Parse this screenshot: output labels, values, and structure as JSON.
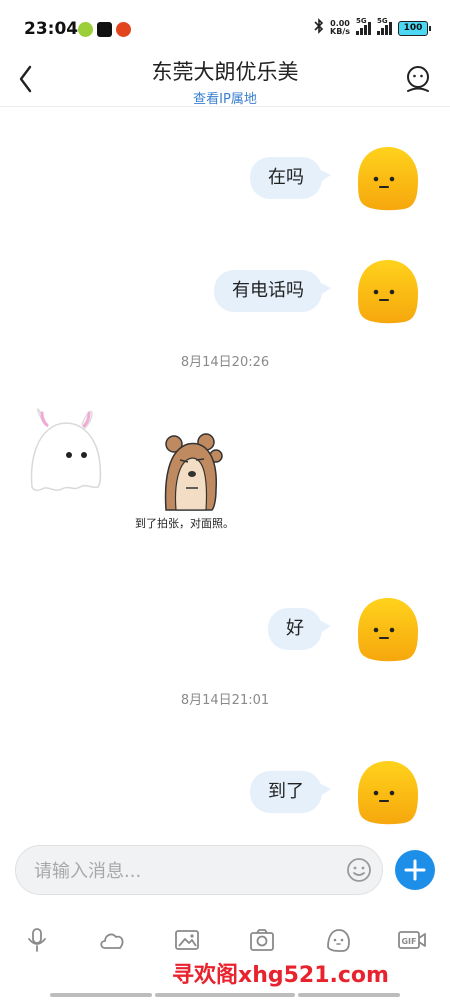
{
  "status_bar": {
    "time": "23:04",
    "net_speed_value": "0.00",
    "net_speed_unit": "KB/s",
    "signal1_label": "5G",
    "signal2_label": "5G",
    "battery": "100"
  },
  "header": {
    "title": "东莞大朗优乐美",
    "subtitle": "查看IP属地"
  },
  "messages": [
    {
      "text": "在吗"
    },
    {
      "text": "有电话吗"
    },
    {
      "text": "好"
    },
    {
      "text": "到了"
    }
  ],
  "timestamps": [
    "8月14日20:26",
    "8月14日21:01"
  ],
  "sticker": {
    "caption": "到了拍张，对面照。"
  },
  "input": {
    "placeholder": "请输入消息..."
  },
  "toolbar": {
    "items": [
      "voice-icon",
      "cloud-icon",
      "image-icon",
      "camera-icon",
      "emoji-icon",
      "gif-icon"
    ],
    "gif_label": "GIF"
  },
  "watermark": "寻欢阁xhg521.com",
  "colors": {
    "bubble": "#e6f0fb",
    "accent": "#1e8fe8",
    "avatar": "#fbb514",
    "watermark": "#e8232e"
  }
}
